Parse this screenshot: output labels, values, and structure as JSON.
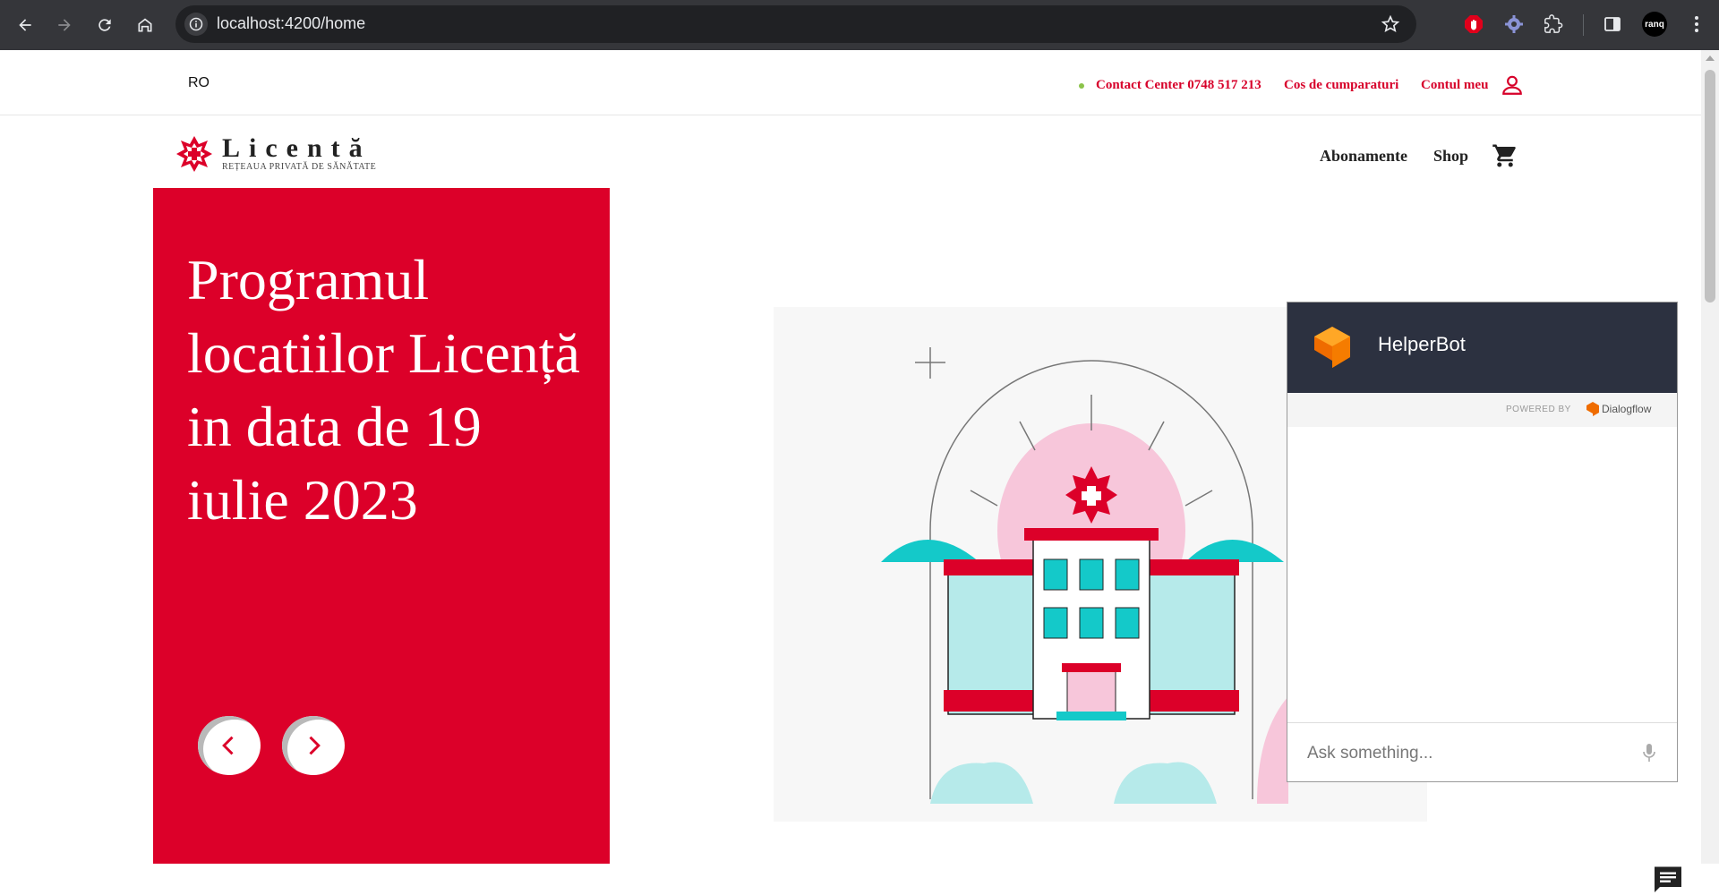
{
  "browser": {
    "url": "localhost:4200/home",
    "profile_label": "ranq"
  },
  "topbar": {
    "language": "RO",
    "contact": "Contact Center 0748 517 213",
    "cart_link": "Cos de cumparaturi",
    "account_link": "Contul meu"
  },
  "brand": {
    "name": "Licentă",
    "tagline": "REȚEAUA PRIVATĂ DE SĂNĂTATE"
  },
  "nav": {
    "subscriptions": "Abonamente",
    "shop": "Shop"
  },
  "hero": {
    "title": "Programul locatiilor Licență in data de 19 iulie 2023"
  },
  "chat": {
    "title": "HelperBot",
    "powered_by": "POWERED BY",
    "provider": "Dialogflow",
    "placeholder": "Ask something..."
  },
  "colors": {
    "brand_red": "#dc0029",
    "chat_header": "#2c3140"
  }
}
